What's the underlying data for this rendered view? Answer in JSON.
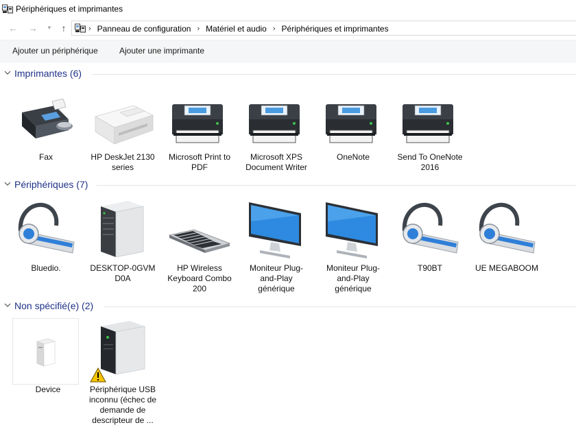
{
  "window": {
    "title": "Périphériques et imprimantes"
  },
  "address": {
    "breadcrumbs": [
      "Panneau de configuration",
      "Matériel et audio",
      "Périphériques et imprimantes"
    ]
  },
  "toolbar": {
    "add_device_label": "Ajouter un périphérique",
    "add_printer_label": "Ajouter une imprimante"
  },
  "groups": {
    "printers": {
      "title": "Imprimantes (6)",
      "items": [
        {
          "label": "Fax",
          "icon": "fax-icon"
        },
        {
          "label": "HP DeskJet 2130 series",
          "icon": "inkjet-printer-icon"
        },
        {
          "label": "Microsoft Print to PDF",
          "icon": "printer-icon"
        },
        {
          "label": "Microsoft XPS Document Writer",
          "icon": "printer-icon"
        },
        {
          "label": "OneNote",
          "icon": "printer-icon"
        },
        {
          "label": "Send To OneNote 2016",
          "icon": "printer-icon"
        }
      ]
    },
    "devices": {
      "title": "Périphériques (7)",
      "items": [
        {
          "label": "Bluedio.",
          "icon": "headset-icon"
        },
        {
          "label": "DESKTOP-0GVM D0A",
          "icon": "computer-tower-icon"
        },
        {
          "label": "HP Wireless Keyboard Combo 200",
          "icon": "keyboard-icon"
        },
        {
          "label": "Moniteur Plug-and-Play générique",
          "icon": "monitor-icon"
        },
        {
          "label": "Moniteur Plug-and-Play générique",
          "icon": "monitor-icon"
        },
        {
          "label": "T90BT",
          "icon": "headset-icon"
        },
        {
          "label": "UE MEGABOOM",
          "icon": "headset-icon"
        }
      ]
    },
    "unspecified": {
      "title": "Non spécifié(e) (2)",
      "items": [
        {
          "label": "Device",
          "icon": "generic-device-icon"
        },
        {
          "label": "Périphérique USB inconnu (échec de demande de descripteur de ...",
          "icon": "usb-device-warning-icon"
        }
      ]
    }
  },
  "colors": {
    "accent": "#1e3287",
    "toolbar_bg": "#f5f6f7",
    "separator": "#e5e5e5"
  }
}
